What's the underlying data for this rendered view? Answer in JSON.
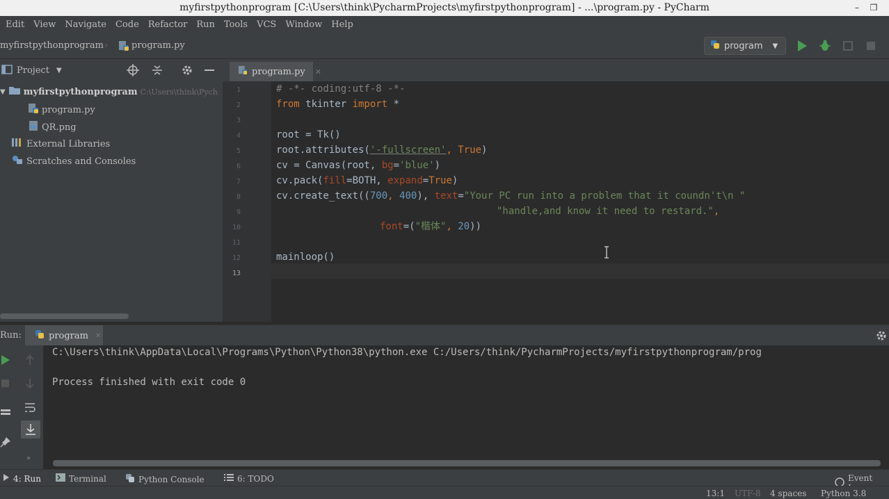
{
  "window": {
    "title": "myfirstpythonprogram [C:\\Users\\think\\PycharmProjects\\myfirstpythonprogram] - ...\\program.py - PyCharm",
    "minimize": "–",
    "restore": "❐"
  },
  "menu": [
    "Edit",
    "View",
    "Navigate",
    "Code",
    "Refactor",
    "Run",
    "Tools",
    "VCS",
    "Window",
    "Help"
  ],
  "breadcrumb": {
    "project": "myfirstpythonprogram",
    "file": "program.py"
  },
  "run_config": {
    "label": "program"
  },
  "project_panel": {
    "title": "Project",
    "tree": [
      {
        "label": "myfirstpythonprogram",
        "path": "C:\\Users\\think\\Pych",
        "icon": "folder-icon"
      },
      {
        "label": "program.py",
        "icon": "python-file-icon"
      },
      {
        "label": "QR.png",
        "icon": "image-file-icon"
      },
      {
        "label": "External Libraries",
        "icon": "libraries-icon"
      },
      {
        "label": "Scratches and Consoles",
        "icon": "scratches-icon"
      }
    ]
  },
  "editor": {
    "tab": "program.py",
    "line_numbers": [
      "1",
      "2",
      "3",
      "4",
      "5",
      "6",
      "7",
      "8",
      "9",
      "10",
      "11",
      "12",
      "13"
    ],
    "lines": {
      "l1": "# -*- coding:utf-8 -*-",
      "l2_kw1": "from",
      "l2_mod": " tkinter ",
      "l2_kw2": "import",
      "l2_rest": " *",
      "l4": "root = Tk()",
      "l5_a": "root.attributes(",
      "l5_b": "'-fullscreen'",
      "l5_c": ", ",
      "l5_d": "True",
      "l5_e": ")",
      "l6_a": "cv = Canvas(root, ",
      "l6_b": "bg",
      "l6_c": "=",
      "l6_d": "'blue'",
      "l6_e": ")",
      "l7_a": "cv.pack(",
      "l7_b": "fill",
      "l7_c": "=BOTH, ",
      "l7_d": "expand",
      "l7_e": "=",
      "l7_f": "True",
      "l7_g": ")",
      "l8_a": "cv.create_text((",
      "l8_b": "700",
      "l8_c": ", ",
      "l8_d": "400",
      "l8_e": "), ",
      "l8_f": "text",
      "l8_g": "=",
      "l8_h": "\"Your PC run into a problem that it coundn't\\n \"",
      "l9": "\"handle,and know it need to restard.\"",
      "l9_comma": ",",
      "l10_a": "font",
      "l10_b": "=(",
      "l10_c": "\"楷体\"",
      "l10_d": ", ",
      "l10_e": "20",
      "l10_f": "))",
      "l12": "mainloop()"
    }
  },
  "run_panel": {
    "label": "Run:",
    "tab": "program",
    "output_line1": "C:\\Users\\think\\AppData\\Local\\Programs\\Python\\Python38\\python.exe C:/Users/think/PycharmProjects/myfirstpythonprogram/prog",
    "output_line2": "Process finished with exit code 0"
  },
  "tool_windows": [
    "4: Run",
    "Terminal",
    "Python Console",
    "6: TODO"
  ],
  "event_log": "Event Log",
  "status": {
    "position": "13:1",
    "encoding": "UTF-8",
    "indent": "4 spaces",
    "interpreter": "Python 3.8"
  },
  "colors": {
    "keyword": "#cc7832",
    "string": "#6a8759",
    "comment": "#808080",
    "number": "#6897bb",
    "param": "#aa4926",
    "run_green": "#499c54"
  }
}
